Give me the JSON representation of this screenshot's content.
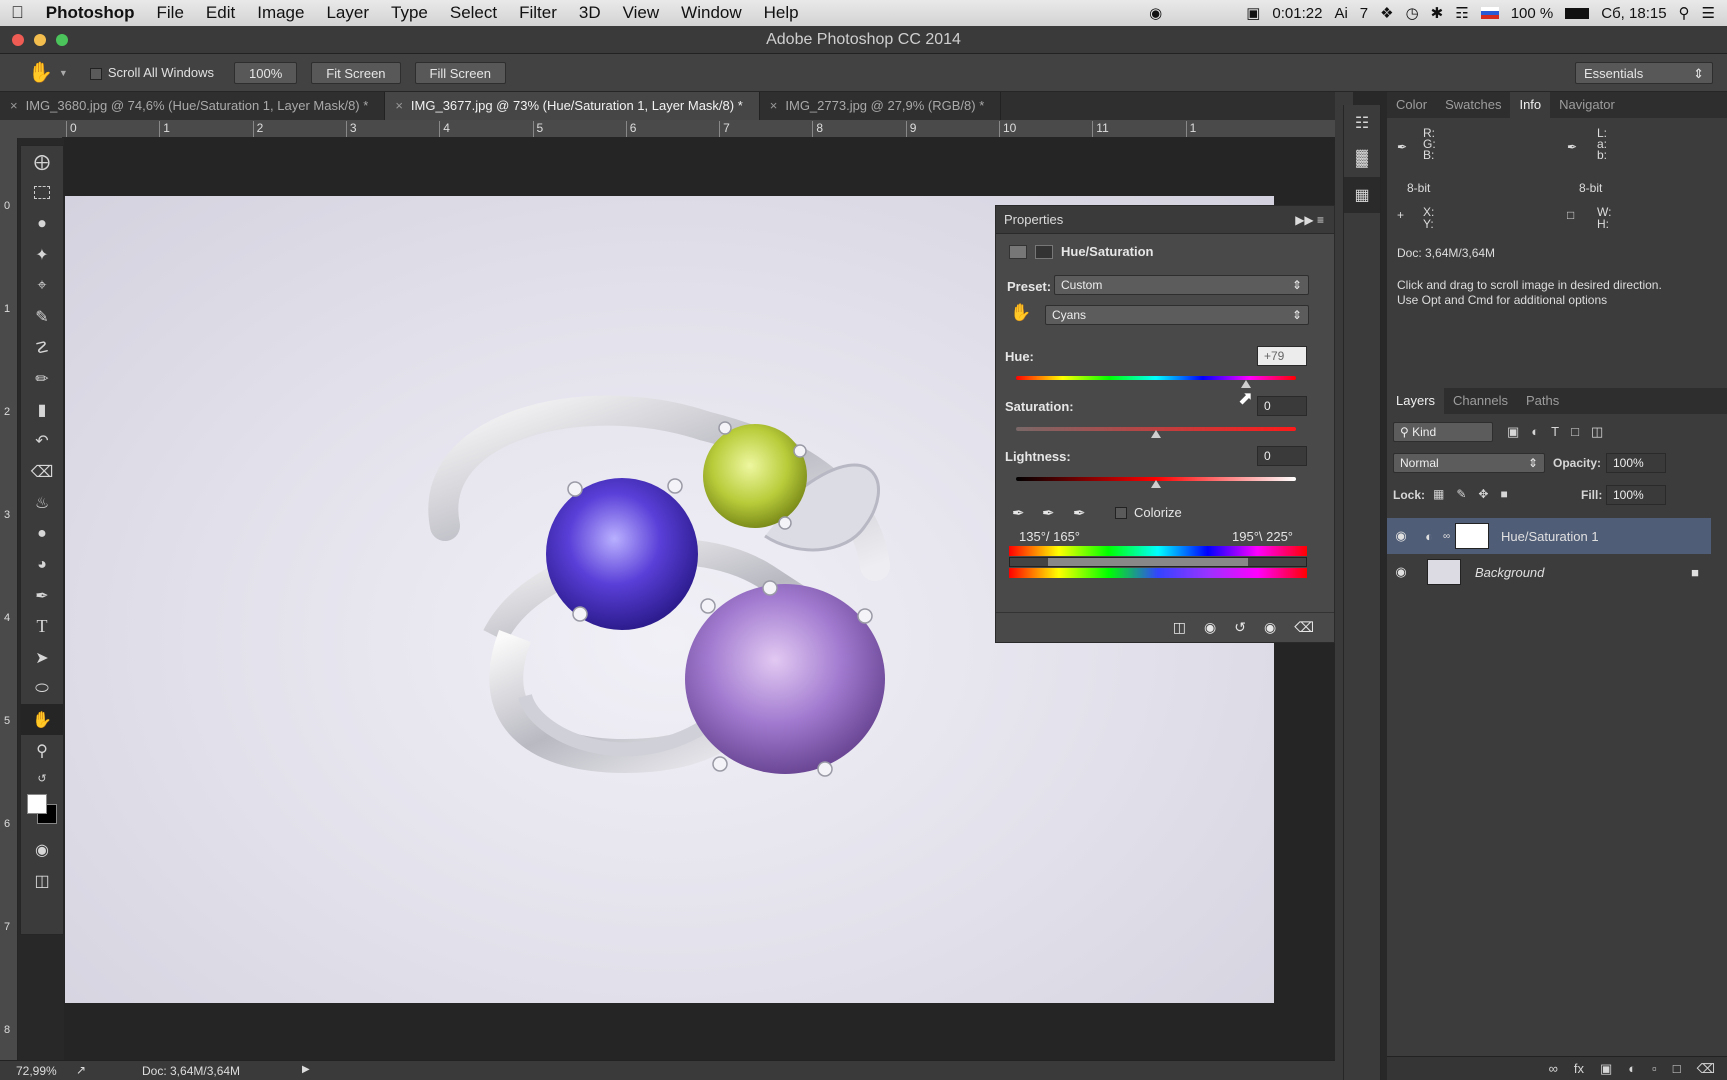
{
  "menubar": {
    "app": "Photoshop",
    "items": [
      "File",
      "Edit",
      "Image",
      "Layer",
      "Type",
      "Select",
      "Filter",
      "3D",
      "View",
      "Window",
      "Help"
    ],
    "timer": "0:01:22",
    "ai_count": "7",
    "battery": "100 %",
    "clock": "Сб, 18:15"
  },
  "window": {
    "title": "Adobe Photoshop CC 2014"
  },
  "options": {
    "scroll_all": "Scroll All Windows",
    "zoom_btn": "100%",
    "fit_btn": "Fit Screen",
    "fill_btn": "Fill Screen",
    "workspace": "Essentials"
  },
  "tabs": [
    "IMG_3680.jpg @ 74,6% (Hue/Saturation 1, Layer Mask/8) *",
    "IMG_3677.jpg @ 73% (Hue/Saturation 1, Layer Mask/8) *",
    "IMG_2773.jpg @ 27,9% (RGB/8) *"
  ],
  "ruler": {
    "h": [
      "0",
      "1",
      "2",
      "3",
      "4",
      "5",
      "6",
      "7",
      "8",
      "9",
      "10",
      "11",
      "1"
    ],
    "v": [
      "0",
      "1",
      "2",
      "3",
      "4",
      "5",
      "6",
      "7",
      "8"
    ]
  },
  "properties": {
    "title": "Properties",
    "adj": "Hue/Saturation",
    "preset_label": "Preset:",
    "preset": "Custom",
    "range": "Cyans",
    "hue_label": "Hue:",
    "hue": "+79",
    "sat_label": "Saturation:",
    "sat": "0",
    "light_label": "Lightness:",
    "light": "0",
    "colorize": "Colorize",
    "range_left": "135°/ 165°",
    "range_right": "195°\\ 225°"
  },
  "info": {
    "tabs": [
      "Color",
      "Swatches",
      "Info",
      "Navigator"
    ],
    "rgb": [
      "R:",
      "G:",
      "B:"
    ],
    "lab": [
      "L:",
      "a:",
      "b:"
    ],
    "bits1": "8-bit",
    "bits2": "8-bit",
    "xy": [
      "X:",
      "Y:"
    ],
    "wh": [
      "W:",
      "H:"
    ],
    "doc": "Doc: 3,64M/3,64M",
    "hint1": "Click and drag to scroll image in desired direction.",
    "hint2": "Use Opt and Cmd for additional options"
  },
  "layers": {
    "tabs": [
      "Layers",
      "Channels",
      "Paths"
    ],
    "kind": "Kind",
    "blend": "Normal",
    "opacity_label": "Opacity:",
    "opacity": "100%",
    "lock_label": "Lock:",
    "fill_label": "Fill:",
    "fill": "100%",
    "items": [
      "Hue/Saturation 1",
      "Background"
    ]
  },
  "status": {
    "zoom": "72,99%",
    "doc": "Doc: 3,64M/3,64M"
  },
  "colors": {
    "accent": "#4f5d77",
    "panel": "#494949"
  }
}
